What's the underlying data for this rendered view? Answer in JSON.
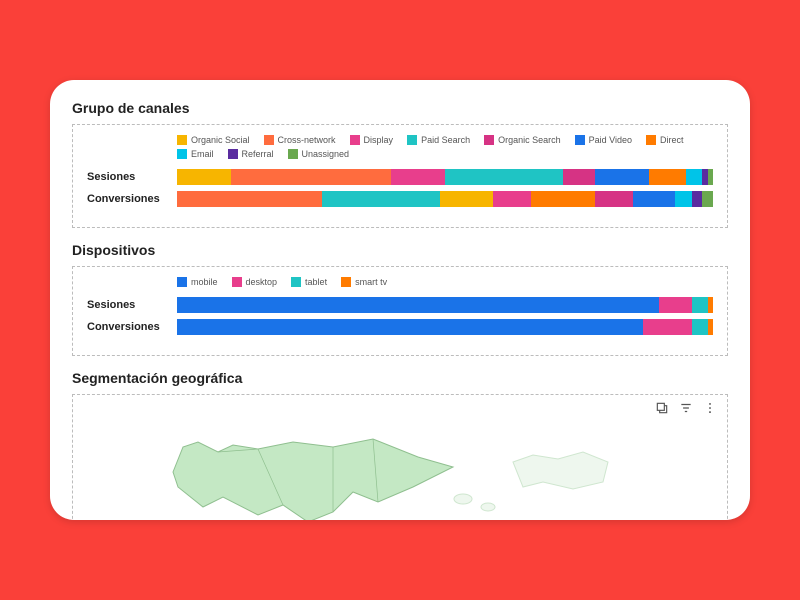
{
  "sections": {
    "channels_title": "Grupo de canales",
    "devices_title": "Dispositivos",
    "geo_title": "Segmentación geográfica"
  },
  "row_labels": {
    "sessions": "Sesiones",
    "conversions": "Conversiones"
  },
  "colors": {
    "organic_social": "#f7b500",
    "cross_network": "#ff6c3e",
    "display": "#e83e8c",
    "paid_search": "#1fc4c4",
    "organic_search": "#d63384",
    "paid_video": "#1a73e8",
    "direct": "#ff7b00",
    "email": "#00c4e8",
    "referral": "#5a2ca0",
    "unassigned": "#6aa84f",
    "mobile": "#1a73e8",
    "desktop": "#e83e8c",
    "tablet": "#1fc4c4",
    "smart_tv": "#ff7b00"
  },
  "chart_data": [
    {
      "type": "bar",
      "subtype": "stacked_horizontal_100pct",
      "title": "Grupo de canales",
      "legend": [
        {
          "key": "organic_social",
          "label": "Organic Social"
        },
        {
          "key": "cross_network",
          "label": "Cross-network"
        },
        {
          "key": "display",
          "label": "Display"
        },
        {
          "key": "paid_search",
          "label": "Paid Search"
        },
        {
          "key": "organic_search",
          "label": "Organic Search"
        },
        {
          "key": "paid_video",
          "label": "Paid Video"
        },
        {
          "key": "direct",
          "label": "Direct"
        },
        {
          "key": "email",
          "label": "Email"
        },
        {
          "key": "referral",
          "label": "Referral"
        },
        {
          "key": "unassigned",
          "label": "Unassigned"
        }
      ],
      "categories": [
        "Sesiones",
        "Conversiones"
      ],
      "series_pct": {
        "Sesiones": [
          {
            "key": "organic_social",
            "value": 10
          },
          {
            "key": "cross_network",
            "value": 30
          },
          {
            "key": "display",
            "value": 10
          },
          {
            "key": "paid_search",
            "value": 22
          },
          {
            "key": "organic_search",
            "value": 6
          },
          {
            "key": "paid_video",
            "value": 10
          },
          {
            "key": "direct",
            "value": 7
          },
          {
            "key": "email",
            "value": 3
          },
          {
            "key": "referral",
            "value": 1
          },
          {
            "key": "unassigned",
            "value": 1
          }
        ],
        "Conversiones": [
          {
            "key": "cross_network",
            "value": 27
          },
          {
            "key": "paid_search",
            "value": 22
          },
          {
            "key": "organic_social",
            "value": 10
          },
          {
            "key": "display",
            "value": 7
          },
          {
            "key": "direct",
            "value": 12
          },
          {
            "key": "organic_search",
            "value": 7
          },
          {
            "key": "paid_video",
            "value": 8
          },
          {
            "key": "email",
            "value": 3
          },
          {
            "key": "referral",
            "value": 2
          },
          {
            "key": "unassigned",
            "value": 2
          }
        ]
      }
    },
    {
      "type": "bar",
      "subtype": "stacked_horizontal_100pct",
      "title": "Dispositivos",
      "legend": [
        {
          "key": "mobile",
          "label": "mobile"
        },
        {
          "key": "desktop",
          "label": "desktop"
        },
        {
          "key": "tablet",
          "label": "tablet"
        },
        {
          "key": "smart_tv",
          "label": "smart tv"
        }
      ],
      "categories": [
        "Sesiones",
        "Conversiones"
      ],
      "series_pct": {
        "Sesiones": [
          {
            "key": "mobile",
            "value": 90
          },
          {
            "key": "desktop",
            "value": 6
          },
          {
            "key": "tablet",
            "value": 3
          },
          {
            "key": "smart_tv",
            "value": 1
          }
        ],
        "Conversiones": [
          {
            "key": "mobile",
            "value": 87
          },
          {
            "key": "desktop",
            "value": 9
          },
          {
            "key": "tablet",
            "value": 3
          },
          {
            "key": "smart_tv",
            "value": 1
          }
        ]
      }
    }
  ]
}
